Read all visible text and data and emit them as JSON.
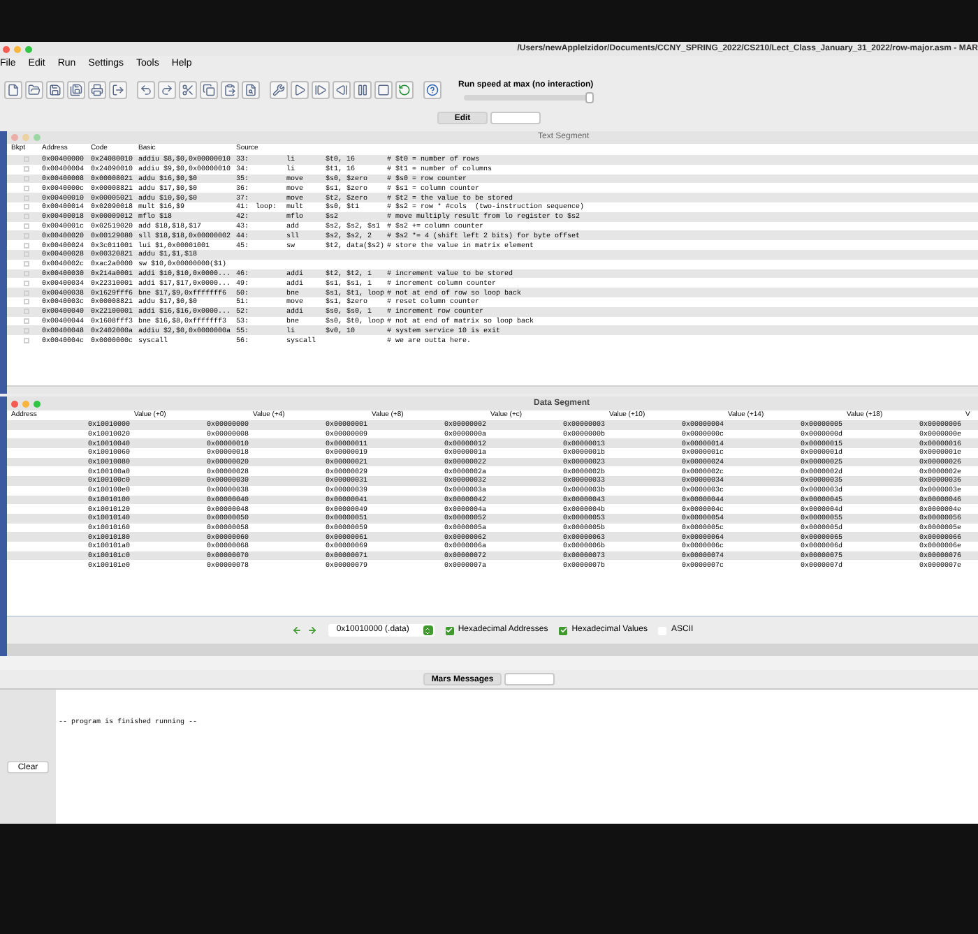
{
  "window": {
    "title": "/Users/newAppleIzidor/Documents/CCNY_SPRING_2022/CS210/Lect_Class_January_31_2022/row-major.asm  - MAR"
  },
  "menu": [
    "File",
    "Edit",
    "Run",
    "Settings",
    "Tools",
    "Help"
  ],
  "run_speed": {
    "label": "Run speed at max (no interaction)",
    "level": 1
  },
  "tabs": [
    {
      "label": "Edit",
      "selected": false
    },
    {
      "selected": true
    }
  ],
  "text_segment": {
    "title": "Text Segment",
    "columns": [
      "Bkpt",
      "Address",
      "Code",
      "Basic",
      "Source"
    ],
    "rows": [
      {
        "breakpoint": false,
        "address": "0x00400000",
        "code": "0x24080010",
        "basic": "addiu $8,$0,0x00000010",
        "line": "33:",
        "op": "li",
        "args": "$t0, 16",
        "comment": "# $t0 = number of rows"
      },
      {
        "breakpoint": false,
        "address": "0x00400004",
        "code": "0x24090010",
        "basic": "addiu $9,$0,0x00000010",
        "line": "34:",
        "op": "li",
        "args": "$t1, 16",
        "comment": "# $t1 = number of columns"
      },
      {
        "breakpoint": false,
        "address": "0x00400008",
        "code": "0x00008021",
        "basic": "addu $16,$0,$0",
        "line": "35:",
        "op": "move",
        "args": "$s0, $zero",
        "comment": "# $s0 = row counter"
      },
      {
        "breakpoint": false,
        "address": "0x0040000c",
        "code": "0x00008821",
        "basic": "addu $17,$0,$0",
        "line": "36:",
        "op": "move",
        "args": "$s1, $zero",
        "comment": "# $s1 = column counter"
      },
      {
        "breakpoint": false,
        "address": "0x00400010",
        "code": "0x00005021",
        "basic": "addu $10,$0,$0",
        "line": "37:",
        "op": "move",
        "args": "$t2, $zero",
        "comment": "# $t2 = the value to be stored"
      },
      {
        "breakpoint": false,
        "address": "0x00400014",
        "code": "0x02090018",
        "basic": "mult $16,$9",
        "line": "41:",
        "label": "loop:",
        "op": "mult",
        "args": "$s0, $t1",
        "comment": "# $s2 = row * #cols  (two-instruction sequence)"
      },
      {
        "breakpoint": false,
        "address": "0x00400018",
        "code": "0x00009012",
        "basic": "mflo $18",
        "line": "42:",
        "op": "mflo",
        "args": "$s2",
        "comment": "# move multiply result from lo register to $s2"
      },
      {
        "breakpoint": false,
        "address": "0x0040001c",
        "code": "0x02519020",
        "basic": "add $18,$18,$17",
        "line": "43:",
        "op": "add",
        "args": "$s2, $s2, $s1",
        "comment": "# $s2 += column counter"
      },
      {
        "breakpoint": false,
        "address": "0x00400020",
        "code": "0x00129080",
        "basic": "sll $18,$18,0x00000002",
        "line": "44:",
        "op": "sll",
        "args": "$s2, $s2, 2",
        "comment": "# $s2 *= 4 (shift left 2 bits) for byte offset"
      },
      {
        "breakpoint": false,
        "address": "0x00400024",
        "code": "0x3c011001",
        "basic": "lui $1,0x00001001",
        "line": "45:",
        "op": "sw",
        "args": "$t2, data($s2)",
        "comment": "# store the value in matrix element"
      },
      {
        "breakpoint": false,
        "address": "0x00400028",
        "code": "0x00320821",
        "basic": "addu $1,$1,$18"
      },
      {
        "breakpoint": false,
        "address": "0x0040002c",
        "code": "0xac2a0000",
        "basic": "sw $10,0x00000000($1)"
      },
      {
        "breakpoint": false,
        "address": "0x00400030",
        "code": "0x214a0001",
        "basic": "addi $10,$10,0x0000...",
        "line": "46:",
        "op": "addi",
        "args": "$t2, $t2, 1",
        "comment": "# increment value to be stored"
      },
      {
        "breakpoint": false,
        "address": "0x00400034",
        "code": "0x22310001",
        "basic": "addi $17,$17,0x0000...",
        "line": "49:",
        "op": "addi",
        "args": "$s1, $s1, 1",
        "comment": "# increment column counter"
      },
      {
        "breakpoint": false,
        "address": "0x00400038",
        "code": "0x1629fff6",
        "basic": "bne $17,$9,0xfffffff6",
        "line": "50:",
        "op": "bne",
        "args": "$s1, $t1, loop",
        "comment": "# not at end of row so loop back"
      },
      {
        "breakpoint": false,
        "address": "0x0040003c",
        "code": "0x00008821",
        "basic": "addu $17,$0,$0",
        "line": "51:",
        "op": "move",
        "args": "$s1, $zero",
        "comment": "# reset column counter"
      },
      {
        "breakpoint": false,
        "address": "0x00400040",
        "code": "0x22100001",
        "basic": "addi $16,$16,0x0000...",
        "line": "52:",
        "op": "addi",
        "args": "$s0, $s0, 1",
        "comment": "# increment row counter"
      },
      {
        "breakpoint": false,
        "address": "0x00400044",
        "code": "0x1608fff3",
        "basic": "bne $16,$8,0xfffffff3",
        "line": "53:",
        "op": "bne",
        "args": "$s0, $t0, loop",
        "comment": "# not at end of matrix so loop back"
      },
      {
        "breakpoint": false,
        "address": "0x00400048",
        "code": "0x2402000a",
        "basic": "addiu $2,$0,0x0000000a",
        "line": "55:",
        "op": "li",
        "args": "$v0, 10",
        "comment": "# system service 10 is exit"
      },
      {
        "breakpoint": false,
        "address": "0x0040004c",
        "code": "0x0000000c",
        "basic": "syscall",
        "line": "56:",
        "op": "syscall",
        "comment": "# we are outta here."
      }
    ]
  },
  "data_segment": {
    "title": "Data Segment",
    "columns": [
      "Address",
      "Value (+0)",
      "Value (+4)",
      "Value (+8)",
      "Value (+c)",
      "Value (+10)",
      "Value (+14)",
      "Value (+18)",
      "V"
    ],
    "rows": [
      {
        "address": "0x10010000",
        "values": [
          "0x00000000",
          "0x00000001",
          "0x00000002",
          "0x00000003",
          "0x00000004",
          "0x00000005",
          "0x00000006"
        ]
      },
      {
        "address": "0x10010020",
        "values": [
          "0x00000008",
          "0x00000009",
          "0x0000000a",
          "0x0000000b",
          "0x0000000c",
          "0x0000000d",
          "0x0000000e"
        ]
      },
      {
        "address": "0x10010040",
        "values": [
          "0x00000010",
          "0x00000011",
          "0x00000012",
          "0x00000013",
          "0x00000014",
          "0x00000015",
          "0x00000016"
        ]
      },
      {
        "address": "0x10010060",
        "values": [
          "0x00000018",
          "0x00000019",
          "0x0000001a",
          "0x0000001b",
          "0x0000001c",
          "0x0000001d",
          "0x0000001e"
        ]
      },
      {
        "address": "0x10010080",
        "values": [
          "0x00000020",
          "0x00000021",
          "0x00000022",
          "0x00000023",
          "0x00000024",
          "0x00000025",
          "0x00000026"
        ]
      },
      {
        "address": "0x100100a0",
        "values": [
          "0x00000028",
          "0x00000029",
          "0x0000002a",
          "0x0000002b",
          "0x0000002c",
          "0x0000002d",
          "0x0000002e"
        ]
      },
      {
        "address": "0x100100c0",
        "values": [
          "0x00000030",
          "0x00000031",
          "0x00000032",
          "0x00000033",
          "0x00000034",
          "0x00000035",
          "0x00000036"
        ]
      },
      {
        "address": "0x100100e0",
        "values": [
          "0x00000038",
          "0x00000039",
          "0x0000003a",
          "0x0000003b",
          "0x0000003c",
          "0x0000003d",
          "0x0000003e"
        ]
      },
      {
        "address": "0x10010100",
        "values": [
          "0x00000040",
          "0x00000041",
          "0x00000042",
          "0x00000043",
          "0x00000044",
          "0x00000045",
          "0x00000046"
        ]
      },
      {
        "address": "0x10010120",
        "values": [
          "0x00000048",
          "0x00000049",
          "0x0000004a",
          "0x0000004b",
          "0x0000004c",
          "0x0000004d",
          "0x0000004e"
        ]
      },
      {
        "address": "0x10010140",
        "values": [
          "0x00000050",
          "0x00000051",
          "0x00000052",
          "0x00000053",
          "0x00000054",
          "0x00000055",
          "0x00000056"
        ]
      },
      {
        "address": "0x10010160",
        "values": [
          "0x00000058",
          "0x00000059",
          "0x0000005a",
          "0x0000005b",
          "0x0000005c",
          "0x0000005d",
          "0x0000005e"
        ]
      },
      {
        "address": "0x10010180",
        "values": [
          "0x00000060",
          "0x00000061",
          "0x00000062",
          "0x00000063",
          "0x00000064",
          "0x00000065",
          "0x00000066"
        ]
      },
      {
        "address": "0x100101a0",
        "values": [
          "0x00000068",
          "0x00000069",
          "0x0000006a",
          "0x0000006b",
          "0x0000006c",
          "0x0000006d",
          "0x0000006e"
        ]
      },
      {
        "address": "0x100101c0",
        "values": [
          "0x00000070",
          "0x00000071",
          "0x00000072",
          "0x00000073",
          "0x00000074",
          "0x00000075",
          "0x00000076"
        ]
      },
      {
        "address": "0x100101e0",
        "values": [
          "0x00000078",
          "0x00000079",
          "0x0000007a",
          "0x0000007b",
          "0x0000007c",
          "0x0000007d",
          "0x0000007e"
        ]
      }
    ],
    "address_selector": "0x10010000 (.data)",
    "options": [
      {
        "label": "Hexadecimal Addresses",
        "checked": true
      },
      {
        "label": "Hexadecimal Values",
        "checked": true
      },
      {
        "label": "ASCII",
        "checked": false
      }
    ]
  },
  "messages": {
    "tabs": [
      {
        "label": "Mars Messages",
        "selected": false
      },
      {
        "selected": true
      }
    ],
    "text": "-- program is finished running --",
    "clear_button": "Clear"
  }
}
